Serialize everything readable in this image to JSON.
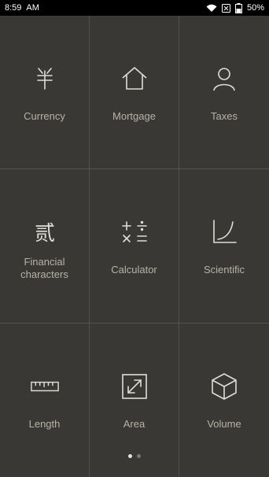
{
  "status_bar": {
    "time": "8:59",
    "period": "AM",
    "battery": "50%",
    "icons": [
      "wifi-icon",
      "sim-blocked-icon",
      "battery-icon"
    ]
  },
  "tiles": [
    {
      "label": "Currency",
      "icon": "yuan-icon"
    },
    {
      "label": "Mortgage",
      "icon": "house-icon"
    },
    {
      "label": "Taxes",
      "icon": "person-icon"
    },
    {
      "label_line1": "Financial",
      "label_line2": "characters",
      "icon": "chinese-numeral-icon",
      "glyph": "贰"
    },
    {
      "label": "Calculator",
      "icon": "arithmetic-icon"
    },
    {
      "label": "Scientific",
      "icon": "curve-graph-icon"
    },
    {
      "label": "Length",
      "icon": "ruler-icon"
    },
    {
      "label": "Area",
      "icon": "resize-arrows-icon"
    },
    {
      "label": "Volume",
      "icon": "cube-icon"
    }
  ],
  "pagination": {
    "pages": 2,
    "current": 1
  },
  "colors": {
    "background": "#3a3834",
    "divider": "#55524c",
    "icon": "#e0ddd6",
    "label": "#b7b2a8"
  }
}
